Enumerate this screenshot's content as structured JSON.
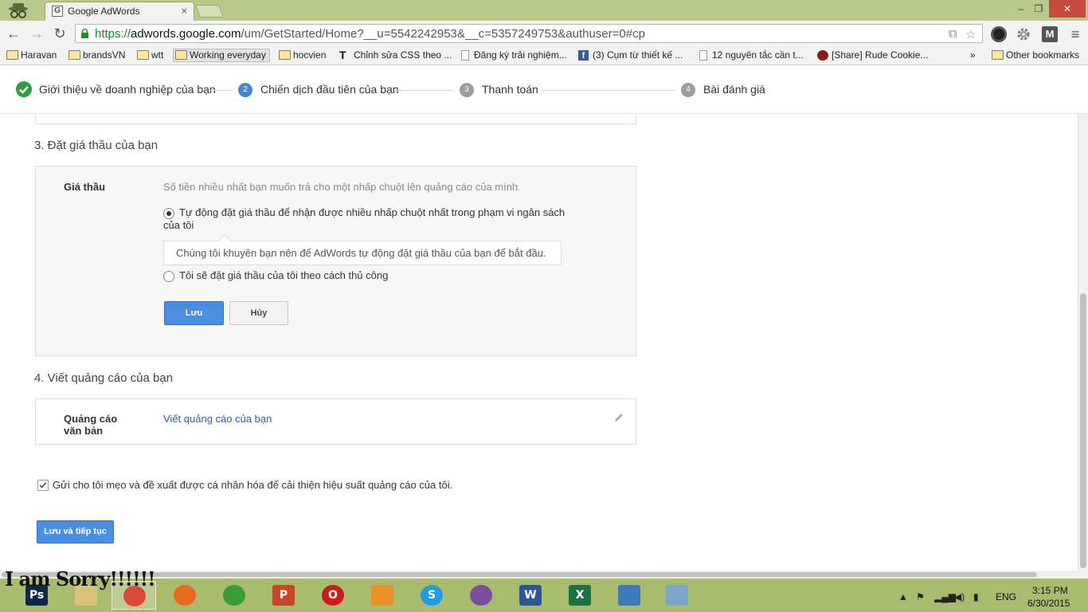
{
  "browser": {
    "tab_title": "Google AdWords",
    "tab_close": "×",
    "window_controls": {
      "minimize": "–",
      "maximize": "❐",
      "close": "✕"
    },
    "url_scheme": "https://",
    "url_host": "adwords.google.com",
    "url_path": "/um/GetStarted/Home?__u=5542242953&__c=5357249753&authuser=0#cp",
    "nav": {
      "back": "←",
      "forward": "→",
      "reload": "↻"
    },
    "bookmarks": [
      {
        "label": "Haravan",
        "icon": "folder-icon"
      },
      {
        "label": "brandsVN",
        "icon": "folder-icon"
      },
      {
        "label": "wtt",
        "icon": "folder-icon"
      },
      {
        "label": "Working everyday",
        "icon": "folder-icon"
      },
      {
        "label": "hocvien",
        "icon": "folder-icon"
      },
      {
        "label": "Chỉnh sửa CSS theo ...",
        "icon": "t-logo-icon"
      },
      {
        "label": "Đăng ký trải nghiệm...",
        "icon": "page-icon"
      },
      {
        "label": "(3) Cụm từ thiết kế ...",
        "icon": "facebook-icon"
      },
      {
        "label": "12 nguyên tắc cần t...",
        "icon": "page-icon"
      },
      {
        "label": "[Share] Rude Cookie...",
        "icon": "cookie-icon"
      }
    ],
    "bookmarks_overflow": "»",
    "other_bookmarks": "Other bookmarks"
  },
  "stepper": {
    "steps": [
      {
        "label": "Giới thiệu về doanh nghiệp của bạn",
        "state": "done"
      },
      {
        "number": "2",
        "label": "Chiến dịch đầu tiên của bạn",
        "state": "active"
      },
      {
        "number": "3",
        "label": "Thanh toán",
        "state": "pending"
      },
      {
        "number": "4",
        "label": "Bài đánh giá",
        "state": "pending"
      }
    ]
  },
  "bid_section": {
    "title": "3. Đặt giá thầu của bạn",
    "label": "Giá thầu",
    "hint": "Số tiền nhiều nhất bạn muốn trả cho một nhấp chuột lên quảng cáo của mình.",
    "option_auto": "Tự động đặt giá thầu để nhận được nhiều nhấp chuột nhất trong phạm vi ngân sách của tôi",
    "option_auto_selected": true,
    "tip": "Chúng tôi khuyên bạn nên để AdWords tự động đặt giá thầu của bạn để bắt đầu.",
    "option_manual": "Tôi sẽ đặt giá thầu của tôi theo cách thủ công",
    "save_label": "Lưu",
    "cancel_label": "Hủy"
  },
  "ad_section": {
    "title": "4. Viết quảng cáo của bạn",
    "label": "Quảng cáo văn bản",
    "link": "Viết quảng cáo của bạn"
  },
  "tips_checkbox": {
    "label": "Gửi cho tôi mẹo và đề xuất được cá nhân hóa để cải thiện hiệu suất quảng cáo của tôi.",
    "checked": true
  },
  "continue_label": "Lưu và tiếp tục",
  "overlay_text": "I am Sorry!!!!!!",
  "taskbar": {
    "apps": [
      {
        "name": "photoshop",
        "glyph": "Ps",
        "color": "#0b2a4a"
      },
      {
        "name": "file-explorer",
        "glyph": "",
        "color": "#d9c27a"
      },
      {
        "name": "chrome",
        "glyph": "",
        "color": "#d94a38"
      },
      {
        "name": "firefox",
        "glyph": "",
        "color": "#e66a1f"
      },
      {
        "name": "corel",
        "glyph": "",
        "color": "#3a9b3a"
      },
      {
        "name": "powerpoint",
        "glyph": "P",
        "color": "#c9462b"
      },
      {
        "name": "opera",
        "glyph": "O",
        "color": "#cc1b1b"
      },
      {
        "name": "foxit-pdf",
        "glyph": "",
        "color": "#e8902a"
      },
      {
        "name": "skype",
        "glyph": "S",
        "color": "#1c9ee0"
      },
      {
        "name": "viber",
        "glyph": "",
        "color": "#7b4fa0"
      },
      {
        "name": "word",
        "glyph": "W",
        "color": "#2b5797"
      },
      {
        "name": "excel",
        "glyph": "X",
        "color": "#1e7145"
      },
      {
        "name": "photo-viewer",
        "glyph": "",
        "color": "#3c7ab8"
      },
      {
        "name": "paint",
        "glyph": "",
        "color": "#7aa6c9"
      }
    ],
    "language": "ENG",
    "time": "3:15 PM",
    "date": "6/30/2015"
  }
}
